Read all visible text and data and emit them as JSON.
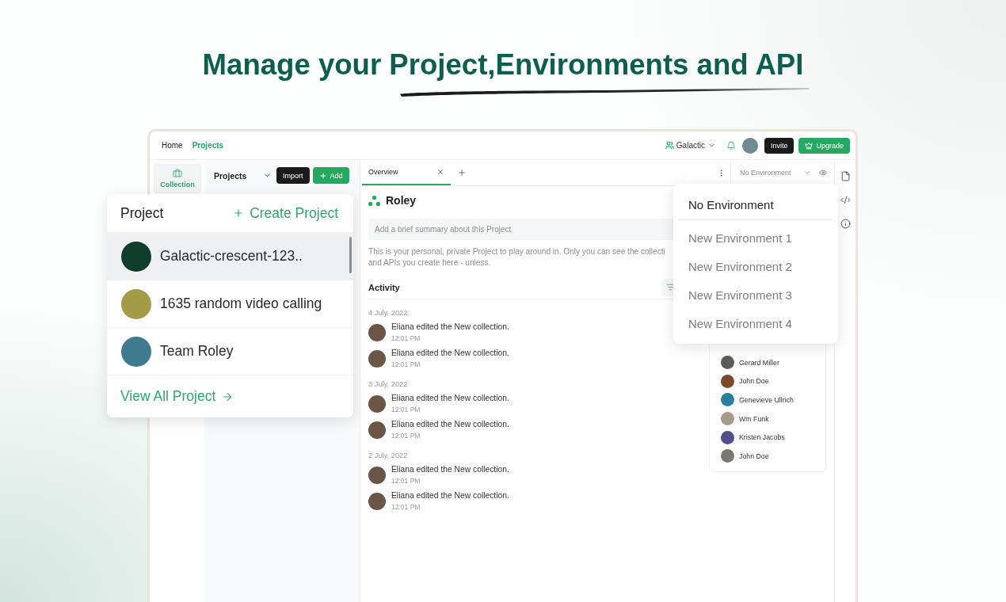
{
  "headline": "Manage your Project,Environments and API",
  "top_nav": {
    "links": [
      {
        "label": "Home",
        "selected": false
      },
      {
        "label": "Projects",
        "selected": true
      }
    ],
    "workspace": "Galactic",
    "buttons": [
      {
        "label": "Invite",
        "kind": "dark"
      },
      {
        "label": "Upgrade",
        "kind": "upgrade"
      }
    ]
  },
  "side_rail": [
    {
      "label": "Collection",
      "selected": true
    }
  ],
  "projects_panel": {
    "title": "Projects",
    "buttons": [
      {
        "label": "Import",
        "kind": "dark"
      },
      {
        "label": "Add",
        "kind": "add"
      }
    ]
  },
  "tabs": [
    {
      "label": "Overview",
      "selected": true
    }
  ],
  "environment_select": {
    "value": "No Environment"
  },
  "project": {
    "name": "Roley",
    "summary_placeholder": "Add a brief summary about this Project",
    "description": [
      "This is your personal, private Project to play around in. Only you can see the collecti",
      "and APIs you create here - unless."
    ]
  },
  "activity": {
    "title": "Activity",
    "groups": [
      {
        "date": "4 July, 2022",
        "items": [
          {
            "text": "Eliana edited the New collection.",
            "time": "12:01 PM"
          },
          {
            "text": "Eliana edited the New collection.",
            "time": "12:01 PM"
          }
        ]
      },
      {
        "date": "3 July, 2022",
        "items": [
          {
            "text": "Eliana edited the New collection.",
            "time": "12:01 PM"
          },
          {
            "text": "Eliana edited the New collection.",
            "time": "12:01 PM"
          }
        ]
      },
      {
        "date": "2 July, 2022",
        "items": [
          {
            "text": "Eliana edited the New collection.",
            "time": "12:01 PM"
          },
          {
            "text": "Eliana edited the New collection.",
            "time": "12:01 PM"
          }
        ]
      }
    ]
  },
  "members": [
    {
      "name": "Gerard Miller"
    },
    {
      "name": "John Doe"
    },
    {
      "name": "Genevieve Ullrich"
    },
    {
      "name": "Wm Funk"
    },
    {
      "name": "Kristen Jacobs"
    },
    {
      "name": "John Doe"
    }
  ],
  "project_popup": {
    "title": "Project",
    "create_label": "Create Project",
    "items": [
      {
        "name": "Galactic-crescent-123..",
        "selected": true
      },
      {
        "name": "1635 random video calling",
        "selected": false
      },
      {
        "name": "Team Roley",
        "selected": false
      }
    ],
    "footer_link": "View All Project"
  },
  "environment_menu": [
    {
      "label": "No Environment",
      "selected": true
    },
    {
      "label": "New Environment 1",
      "selected": false
    },
    {
      "label": "New Environment 2",
      "selected": false
    },
    {
      "label": "New Environment 3",
      "selected": false
    },
    {
      "label": "New Environment 4",
      "selected": false
    }
  ]
}
